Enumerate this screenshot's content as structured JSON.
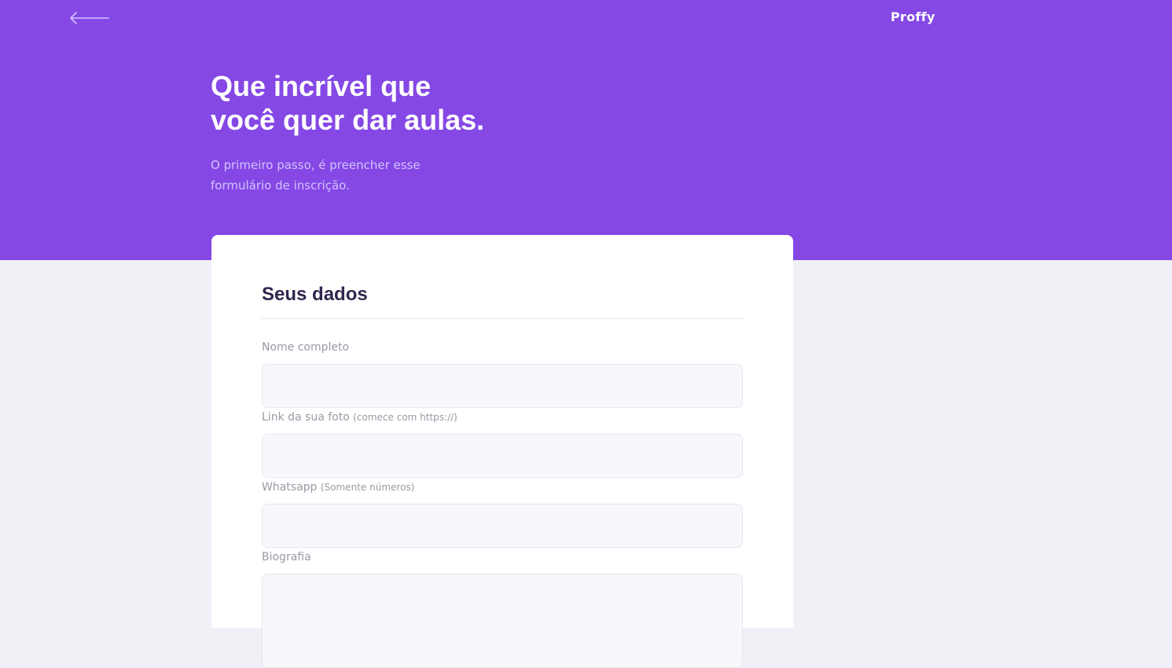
{
  "header": {
    "back_icon": "arrow-left-icon",
    "logo_text": "Proffy"
  },
  "hero": {
    "title_lines": [
      "Que incrível que",
      "você quer dar aulas."
    ],
    "description_lines": [
      "O primeiro passo, é preencher esse",
      "formulário de inscrição."
    ]
  },
  "form": {
    "section_title": "Seus dados",
    "fields": [
      {
        "label": "Nome completo",
        "hint": "",
        "value": "",
        "placeholder": ""
      },
      {
        "label": "Link da sua foto",
        "hint": "(comece com https://)",
        "value": "",
        "placeholder": ""
      },
      {
        "label": "Whatsapp",
        "hint": "(Somente números)",
        "value": "",
        "placeholder": ""
      },
      {
        "label": "Biografia",
        "hint": "",
        "value": "",
        "placeholder": ""
      }
    ]
  },
  "colors": {
    "primary": "#8548E5",
    "background": "#F0F0F7",
    "card": "#FFFFFF",
    "title_in_primary": "#FFFFFF",
    "text_in_primary": "#D4C2FF",
    "text_title": "#32264D",
    "text_complement": "#9C98A6",
    "input_background": "#F8F8FC",
    "line": "#E6E6F0"
  }
}
